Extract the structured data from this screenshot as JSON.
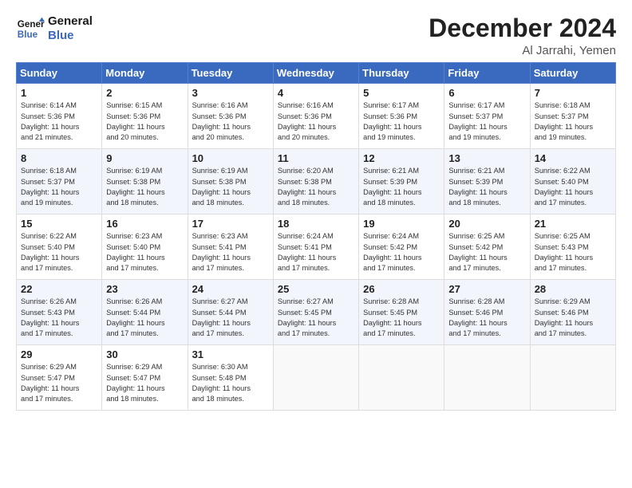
{
  "header": {
    "logo_line1": "General",
    "logo_line2": "Blue",
    "month": "December 2024",
    "location": "Al Jarrahi, Yemen"
  },
  "weekdays": [
    "Sunday",
    "Monday",
    "Tuesday",
    "Wednesday",
    "Thursday",
    "Friday",
    "Saturday"
  ],
  "weeks": [
    [
      {
        "day": "1",
        "lines": [
          "Sunrise: 6:14 AM",
          "Sunset: 5:36 PM",
          "Daylight: 11 hours",
          "and 21 minutes."
        ]
      },
      {
        "day": "2",
        "lines": [
          "Sunrise: 6:15 AM",
          "Sunset: 5:36 PM",
          "Daylight: 11 hours",
          "and 20 minutes."
        ]
      },
      {
        "day": "3",
        "lines": [
          "Sunrise: 6:16 AM",
          "Sunset: 5:36 PM",
          "Daylight: 11 hours",
          "and 20 minutes."
        ]
      },
      {
        "day": "4",
        "lines": [
          "Sunrise: 6:16 AM",
          "Sunset: 5:36 PM",
          "Daylight: 11 hours",
          "and 20 minutes."
        ]
      },
      {
        "day": "5",
        "lines": [
          "Sunrise: 6:17 AM",
          "Sunset: 5:36 PM",
          "Daylight: 11 hours",
          "and 19 minutes."
        ]
      },
      {
        "day": "6",
        "lines": [
          "Sunrise: 6:17 AM",
          "Sunset: 5:37 PM",
          "Daylight: 11 hours",
          "and 19 minutes."
        ]
      },
      {
        "day": "7",
        "lines": [
          "Sunrise: 6:18 AM",
          "Sunset: 5:37 PM",
          "Daylight: 11 hours",
          "and 19 minutes."
        ]
      }
    ],
    [
      {
        "day": "8",
        "lines": [
          "Sunrise: 6:18 AM",
          "Sunset: 5:37 PM",
          "Daylight: 11 hours",
          "and 19 minutes."
        ]
      },
      {
        "day": "9",
        "lines": [
          "Sunrise: 6:19 AM",
          "Sunset: 5:38 PM",
          "Daylight: 11 hours",
          "and 18 minutes."
        ]
      },
      {
        "day": "10",
        "lines": [
          "Sunrise: 6:19 AM",
          "Sunset: 5:38 PM",
          "Daylight: 11 hours",
          "and 18 minutes."
        ]
      },
      {
        "day": "11",
        "lines": [
          "Sunrise: 6:20 AM",
          "Sunset: 5:38 PM",
          "Daylight: 11 hours",
          "and 18 minutes."
        ]
      },
      {
        "day": "12",
        "lines": [
          "Sunrise: 6:21 AM",
          "Sunset: 5:39 PM",
          "Daylight: 11 hours",
          "and 18 minutes."
        ]
      },
      {
        "day": "13",
        "lines": [
          "Sunrise: 6:21 AM",
          "Sunset: 5:39 PM",
          "Daylight: 11 hours",
          "and 18 minutes."
        ]
      },
      {
        "day": "14",
        "lines": [
          "Sunrise: 6:22 AM",
          "Sunset: 5:40 PM",
          "Daylight: 11 hours",
          "and 17 minutes."
        ]
      }
    ],
    [
      {
        "day": "15",
        "lines": [
          "Sunrise: 6:22 AM",
          "Sunset: 5:40 PM",
          "Daylight: 11 hours",
          "and 17 minutes."
        ]
      },
      {
        "day": "16",
        "lines": [
          "Sunrise: 6:23 AM",
          "Sunset: 5:40 PM",
          "Daylight: 11 hours",
          "and 17 minutes."
        ]
      },
      {
        "day": "17",
        "lines": [
          "Sunrise: 6:23 AM",
          "Sunset: 5:41 PM",
          "Daylight: 11 hours",
          "and 17 minutes."
        ]
      },
      {
        "day": "18",
        "lines": [
          "Sunrise: 6:24 AM",
          "Sunset: 5:41 PM",
          "Daylight: 11 hours",
          "and 17 minutes."
        ]
      },
      {
        "day": "19",
        "lines": [
          "Sunrise: 6:24 AM",
          "Sunset: 5:42 PM",
          "Daylight: 11 hours",
          "and 17 minutes."
        ]
      },
      {
        "day": "20",
        "lines": [
          "Sunrise: 6:25 AM",
          "Sunset: 5:42 PM",
          "Daylight: 11 hours",
          "and 17 minutes."
        ]
      },
      {
        "day": "21",
        "lines": [
          "Sunrise: 6:25 AM",
          "Sunset: 5:43 PM",
          "Daylight: 11 hours",
          "and 17 minutes."
        ]
      }
    ],
    [
      {
        "day": "22",
        "lines": [
          "Sunrise: 6:26 AM",
          "Sunset: 5:43 PM",
          "Daylight: 11 hours",
          "and 17 minutes."
        ]
      },
      {
        "day": "23",
        "lines": [
          "Sunrise: 6:26 AM",
          "Sunset: 5:44 PM",
          "Daylight: 11 hours",
          "and 17 minutes."
        ]
      },
      {
        "day": "24",
        "lines": [
          "Sunrise: 6:27 AM",
          "Sunset: 5:44 PM",
          "Daylight: 11 hours",
          "and 17 minutes."
        ]
      },
      {
        "day": "25",
        "lines": [
          "Sunrise: 6:27 AM",
          "Sunset: 5:45 PM",
          "Daylight: 11 hours",
          "and 17 minutes."
        ]
      },
      {
        "day": "26",
        "lines": [
          "Sunrise: 6:28 AM",
          "Sunset: 5:45 PM",
          "Daylight: 11 hours",
          "and 17 minutes."
        ]
      },
      {
        "day": "27",
        "lines": [
          "Sunrise: 6:28 AM",
          "Sunset: 5:46 PM",
          "Daylight: 11 hours",
          "and 17 minutes."
        ]
      },
      {
        "day": "28",
        "lines": [
          "Sunrise: 6:29 AM",
          "Sunset: 5:46 PM",
          "Daylight: 11 hours",
          "and 17 minutes."
        ]
      }
    ],
    [
      {
        "day": "29",
        "lines": [
          "Sunrise: 6:29 AM",
          "Sunset: 5:47 PM",
          "Daylight: 11 hours",
          "and 17 minutes."
        ]
      },
      {
        "day": "30",
        "lines": [
          "Sunrise: 6:29 AM",
          "Sunset: 5:47 PM",
          "Daylight: 11 hours",
          "and 18 minutes."
        ]
      },
      {
        "day": "31",
        "lines": [
          "Sunrise: 6:30 AM",
          "Sunset: 5:48 PM",
          "Daylight: 11 hours",
          "and 18 minutes."
        ]
      },
      null,
      null,
      null,
      null
    ]
  ]
}
